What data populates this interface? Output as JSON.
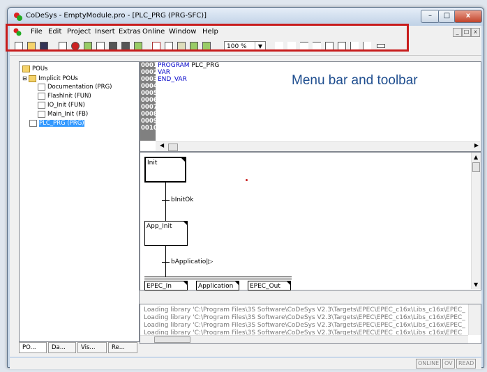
{
  "window": {
    "title": "CoDeSys - EmptyModule.pro - [PLC_PRG (PRG-SFC)]"
  },
  "menubar": {
    "items": [
      "File",
      "Edit",
      "Project",
      "Insert",
      "Extras",
      "Online",
      "Window",
      "Help"
    ]
  },
  "toolbar": {
    "zoom": "100 %"
  },
  "annotation": {
    "text": "Menu bar and toolbar"
  },
  "tree": {
    "root": "POUs",
    "folder": "Implicit POUs",
    "children": [
      "Documentation (PRG)",
      "FlashInit (FUN)",
      "IO_Init (FUN)",
      "Main_Init (FB)"
    ],
    "selected": "PLC_PRG (PRG)"
  },
  "tabs": [
    "PO...",
    "Da...",
    "Vis...",
    "Re..."
  ],
  "declaration": {
    "line_numbers": [
      "0001",
      "0002",
      "0003",
      "0004",
      "0005",
      "0006",
      "0007",
      "0008",
      "0009",
      "0010"
    ],
    "lines": [
      {
        "keyword": "PROGRAM",
        "rest": " PLC_PRG"
      },
      {
        "keyword": "VAR",
        "rest": ""
      },
      {
        "keyword": "END_VAR",
        "rest": ""
      }
    ]
  },
  "sfc": {
    "steps": [
      "Init",
      "App_Init",
      "EPEC_In",
      "Application",
      "EPEC_Out"
    ],
    "transitions": [
      "bInitOk",
      "bApplicatio"
    ]
  },
  "messages": [
    "Loading library 'C:\\Program Files\\3S Software\\CoDeSys V2.3\\Targets\\EPEC\\EPEC_c16x\\Libs_c16x\\EPEC_",
    "Loading library 'C:\\Program Files\\3S Software\\CoDeSys V2.3\\Targets\\EPEC\\EPEC_c16x\\Libs_c16x\\EPEC_",
    "Loading library 'C:\\Program Files\\3S Software\\CoDeSys V2.3\\Targets\\EPEC\\EPEC_c16x\\Libs_c16x\\EPEC_",
    "Loading library 'C:\\Program Files\\3S Software\\CoDeSys V2.3\\Targets\\EPEC\\EPEC_c16x\\Libs_c16x\\EPEC_"
  ],
  "status": [
    "ONLINE",
    "OV",
    "READ"
  ],
  "colors": {
    "highlight": "#c81d1d",
    "annotation": "#1f4e8f",
    "selection": "#3399ff",
    "keyword": "#0000c8"
  }
}
